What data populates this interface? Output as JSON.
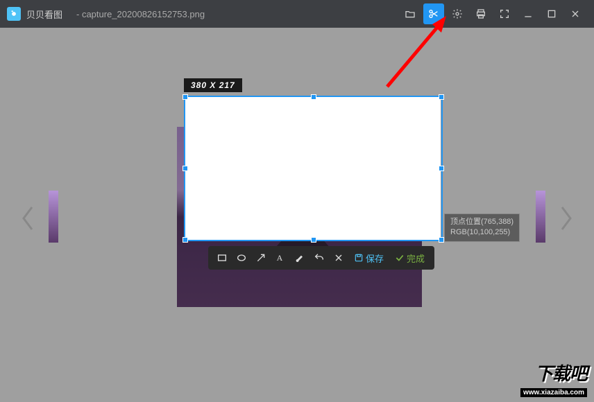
{
  "app": {
    "name": "贝贝看图",
    "file": "- capture_20200826152753.png"
  },
  "selection": {
    "dimensions": "380 X 217"
  },
  "info": {
    "line1": "顶点位置(765,388)",
    "line2": "RGB(10,100,255)"
  },
  "actionbar": {
    "save": "保存",
    "done": "完成"
  },
  "watermark": {
    "main": "下载吧",
    "url": "www.xiazaiba.com"
  }
}
